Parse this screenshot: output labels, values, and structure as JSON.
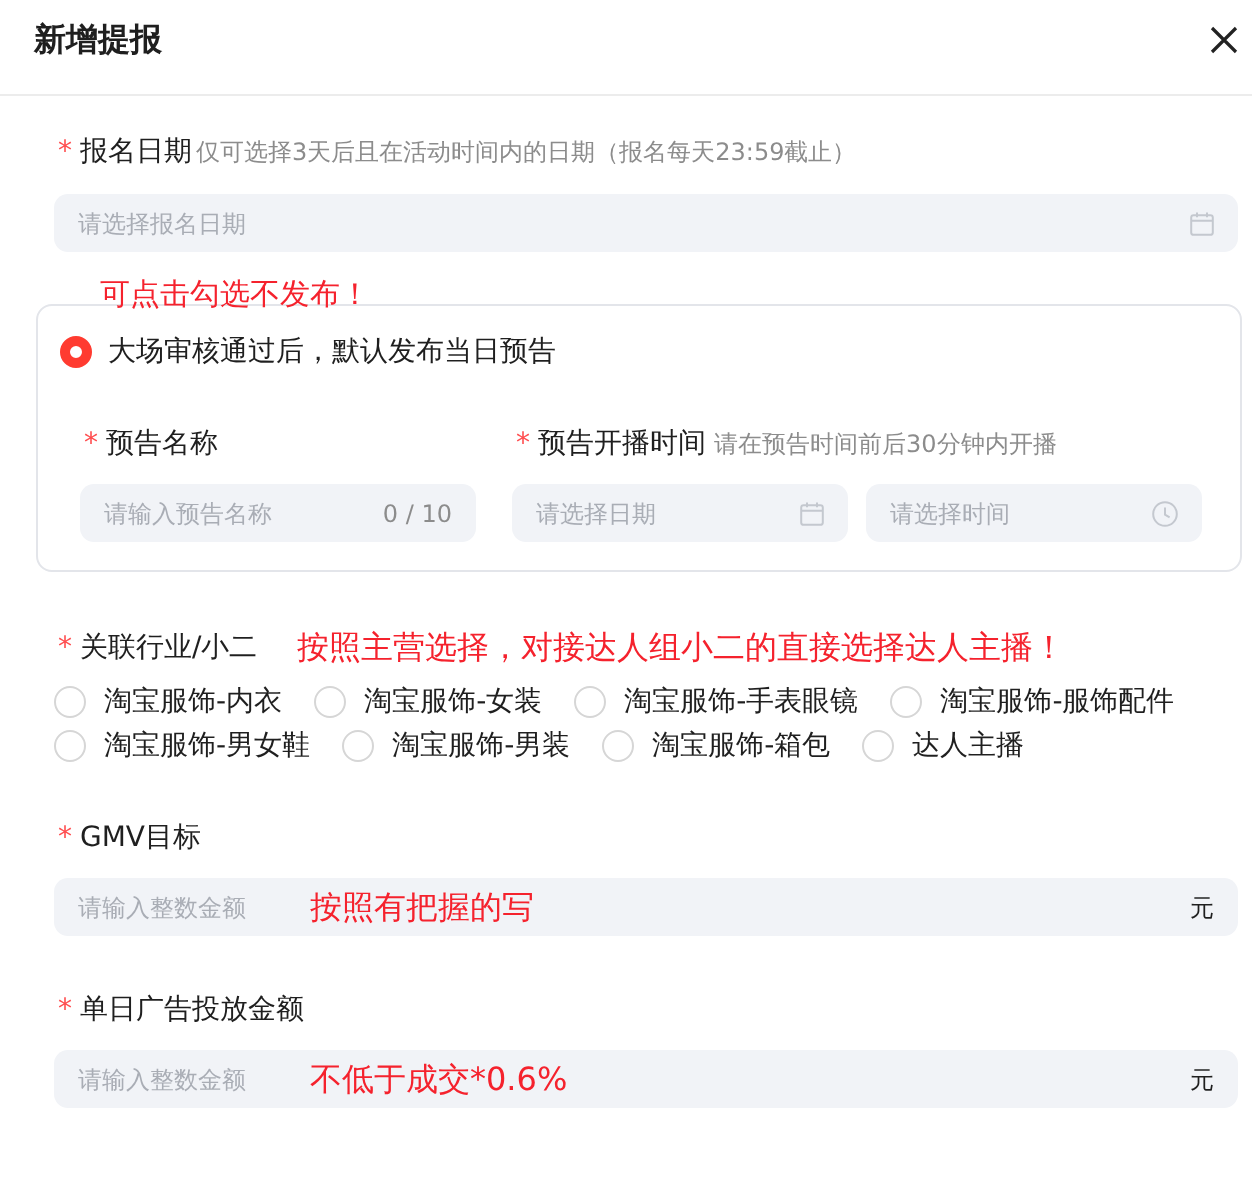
{
  "dialog": {
    "title": "新增提报"
  },
  "fields": [
    {
      "kind": "date",
      "required_mark": "*",
      "label": "报名日期",
      "hint": "仅可选择3天后且在活动时间内的日期（报名每天23:59截止）",
      "placeholder": "请选择报名日期"
    },
    {
      "kind": "preview",
      "annotation": "可点击勾选不发布！",
      "toggle": {
        "label": "大场审核通过后，默认发布当日预告",
        "checked": true
      },
      "name": {
        "required_mark": "*",
        "label": "预告名称",
        "placeholder": "请输入预告名称",
        "count": "0 / 10"
      },
      "time": {
        "required_mark": "*",
        "label": "预告开播时间",
        "hint": "请在预告时间前后30分钟内开播",
        "date_placeholder": "请选择日期",
        "time_placeholder": "请选择时间"
      }
    },
    {
      "kind": "choice",
      "required_mark": "*",
      "label": "关联行业/小二",
      "annotation": "按照主营选择，对接达人组小二的直接选择达人主播！",
      "options": [
        {
          "label": "淘宝服饰-内衣",
          "selected": false
        },
        {
          "label": "淘宝服饰-女装",
          "selected": false
        },
        {
          "label": "淘宝服饰-手表眼镜",
          "selected": false
        },
        {
          "label": "淘宝服饰-服饰配件",
          "selected": false
        },
        {
          "label": "淘宝服饰-男女鞋",
          "selected": false
        },
        {
          "label": "淘宝服饰-男装",
          "selected": false
        },
        {
          "label": "淘宝服饰-箱包",
          "selected": false
        },
        {
          "label": "达人主播",
          "selected": false
        }
      ]
    },
    {
      "kind": "amount",
      "required_mark": "*",
      "label": "GMV目标",
      "placeholder": "请输入整数金额",
      "unit": "元",
      "annotation": "按照有把握的写"
    },
    {
      "kind": "amount",
      "required_mark": "*",
      "label": "单日广告投放金额",
      "placeholder": "请输入整数金额",
      "unit": "元",
      "annotation": "不低于成交*0.6%"
    }
  ]
}
